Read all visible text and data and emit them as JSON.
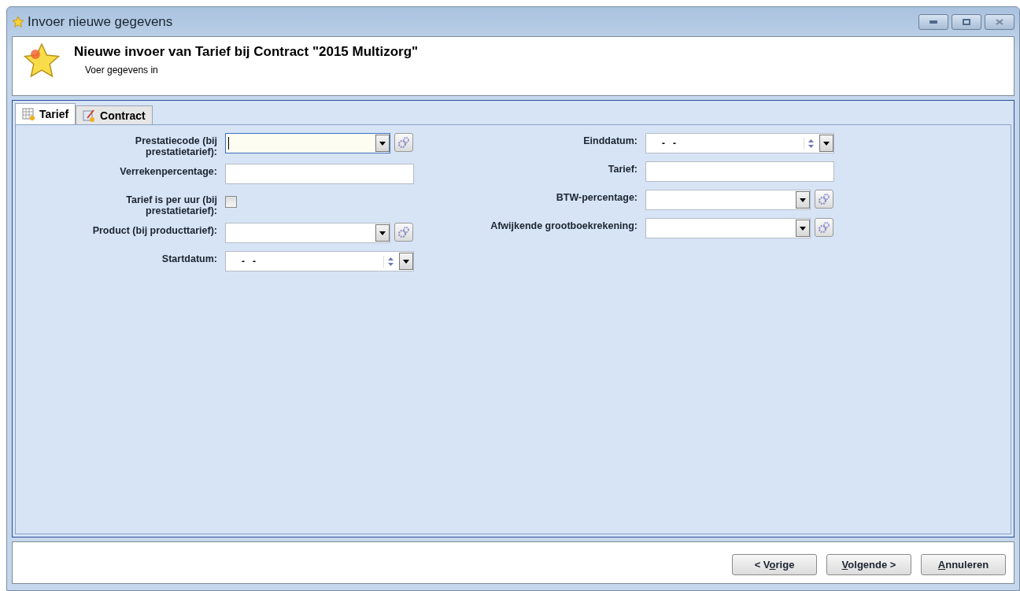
{
  "window": {
    "title": "Invoer nieuwe gegevens"
  },
  "header": {
    "title": "Nieuwe invoer van Tarief bij Contract \"2015 Multizorg\"",
    "subtitle": "Voer gegevens in"
  },
  "tabs": [
    {
      "label": "Tarief",
      "selected": true
    },
    {
      "label": "Contract",
      "selected": false
    }
  ],
  "form": {
    "left": [
      {
        "kind": "combo",
        "label": "Prestatiecode (bij prestatietarief):",
        "focused": true
      },
      {
        "kind": "text",
        "label": "Verrekenpercentage:",
        "focused": false
      },
      {
        "kind": "checkbox",
        "label": "Tarief is per uur (bij prestatietarief):",
        "checked": false
      },
      {
        "kind": "combo",
        "label": "Product (bij producttarief):",
        "focused": false
      },
      {
        "kind": "date",
        "label": "Startdatum:",
        "value": "-   -"
      }
    ],
    "right": [
      {
        "kind": "date",
        "label": "Einddatum:",
        "value": "-   -"
      },
      {
        "kind": "text",
        "label": "Tarief:",
        "focused": false
      },
      {
        "kind": "combo",
        "label": "BTW-percentage:",
        "focused": false
      },
      {
        "kind": "combo",
        "label": "Afwijkende grootboekrekening:",
        "focused": false
      }
    ]
  },
  "buttons": [
    {
      "before": "< V",
      "key": "o",
      "after": "rige"
    },
    {
      "key": "V",
      "after": "olgende >"
    },
    {
      "key": "A",
      "after": "nnuleren"
    }
  ]
}
